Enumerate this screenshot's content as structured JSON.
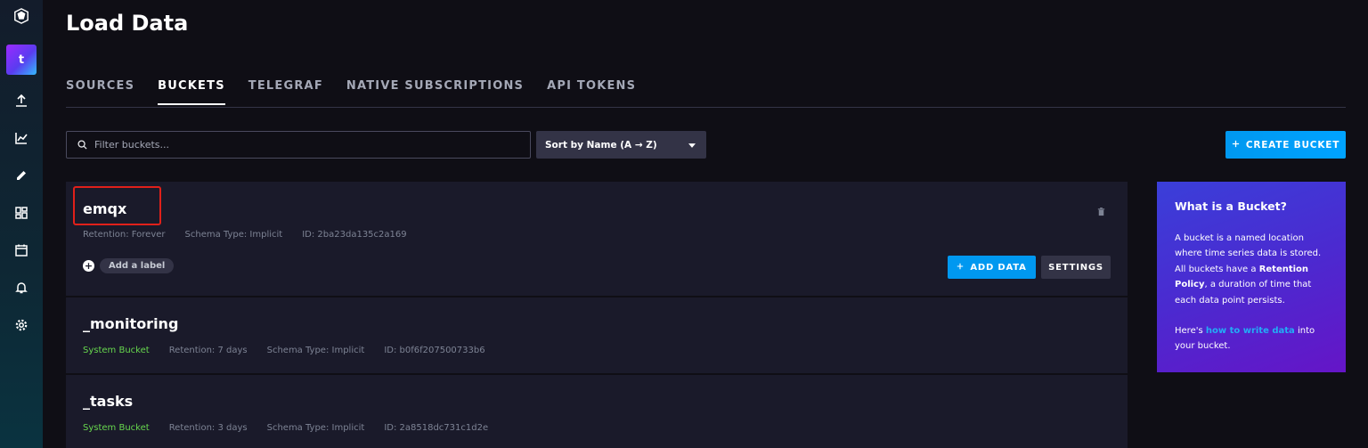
{
  "sidebar": {
    "org_initial": "t",
    "icons": [
      "data-upload-icon",
      "graph-icon",
      "pencil-icon",
      "dashboard-icon",
      "calendar-icon",
      "bell-icon",
      "gear-icon"
    ]
  },
  "page": {
    "title": "Load Data"
  },
  "tabs": [
    {
      "label": "SOURCES",
      "active": false
    },
    {
      "label": "BUCKETS",
      "active": true
    },
    {
      "label": "TELEGRAF",
      "active": false
    },
    {
      "label": "NATIVE SUBSCRIPTIONS",
      "active": false
    },
    {
      "label": "API TOKENS",
      "active": false
    }
  ],
  "toolbar": {
    "filter_placeholder": "Filter buckets...",
    "sort_label": "Sort by Name (A → Z)",
    "create_label": "CREATE BUCKET"
  },
  "buckets": [
    {
      "name": "emqx",
      "retention": "Retention: Forever",
      "schema": "Schema Type: Implicit",
      "id": "ID: 2ba23da135c2a169",
      "add_label": "Add a label",
      "add_data": "ADD DATA",
      "settings": "SETTINGS"
    },
    {
      "name": "_monitoring",
      "system": "System Bucket",
      "retention": "Retention: 7 days",
      "schema": "Schema Type: Implicit",
      "id": "ID: b0f6f207500733b6"
    },
    {
      "name": "_tasks",
      "system": "System Bucket",
      "retention": "Retention: 3 days",
      "schema": "Schema Type: Implicit",
      "id": "ID: 2a8518dc731c1d2e"
    }
  ],
  "info": {
    "title": "What is a Bucket?",
    "p1_a": "A bucket is a named location where time series data is stored. All buckets have a ",
    "p1_b": "Retention Policy",
    "p1_c": ", a duration of time that each data point persists.",
    "p2_a": "Here's ",
    "p2_link": "how to write data",
    "p2_b": " into your bucket."
  },
  "colors": {
    "accent": "#0098f0",
    "system_bucket": "#67d74e",
    "highlight": "#e0201a"
  }
}
